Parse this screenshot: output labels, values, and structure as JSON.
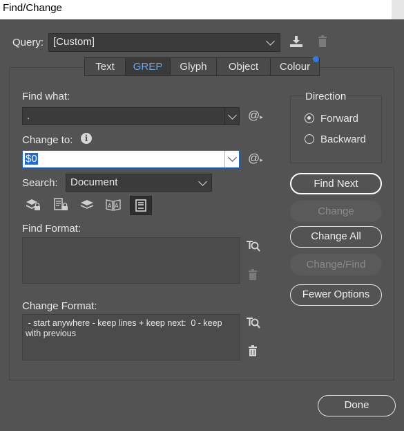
{
  "window": {
    "title": "Find/Change"
  },
  "query": {
    "label": "Query:",
    "value": "[Custom]"
  },
  "tabs": [
    {
      "label": "Text",
      "active": false
    },
    {
      "label": "GREP",
      "active": true
    },
    {
      "label": "Glyph",
      "active": false
    },
    {
      "label": "Object",
      "active": false
    },
    {
      "label": "Colour",
      "active": false
    }
  ],
  "find_what": {
    "label": "Find what:",
    "value": "."
  },
  "change_to": {
    "label": "Change to:",
    "value": "$0"
  },
  "search": {
    "label": "Search:",
    "value": "Document"
  },
  "find_format": {
    "label": "Find Format:",
    "value": ""
  },
  "change_format": {
    "label": "Change Format:",
    "value": " - start anywhere - keep lines + keep next:  0 - keep with previous"
  },
  "direction": {
    "label": "Direction",
    "options": [
      {
        "label": "Forward",
        "selected": true
      },
      {
        "label": "Backward",
        "selected": false
      }
    ]
  },
  "buttons": {
    "find_next": "Find Next",
    "change": "Change",
    "change_all": "Change All",
    "change_find": "Change/Find",
    "fewer_options": "Fewer Options",
    "done": "Done"
  },
  "icons": {
    "save_query": "save-query-icon",
    "delete_query": "trash-icon",
    "special_chars": "at-sign-icon",
    "info": "info-icon",
    "format_search": "format-search-icon",
    "clear_format": "trash-icon"
  },
  "colors": {
    "background": "#535353",
    "active_tab": "#6aa6e8",
    "selection": "#1d6ad1",
    "notification_dot": "#2e7ce6"
  }
}
